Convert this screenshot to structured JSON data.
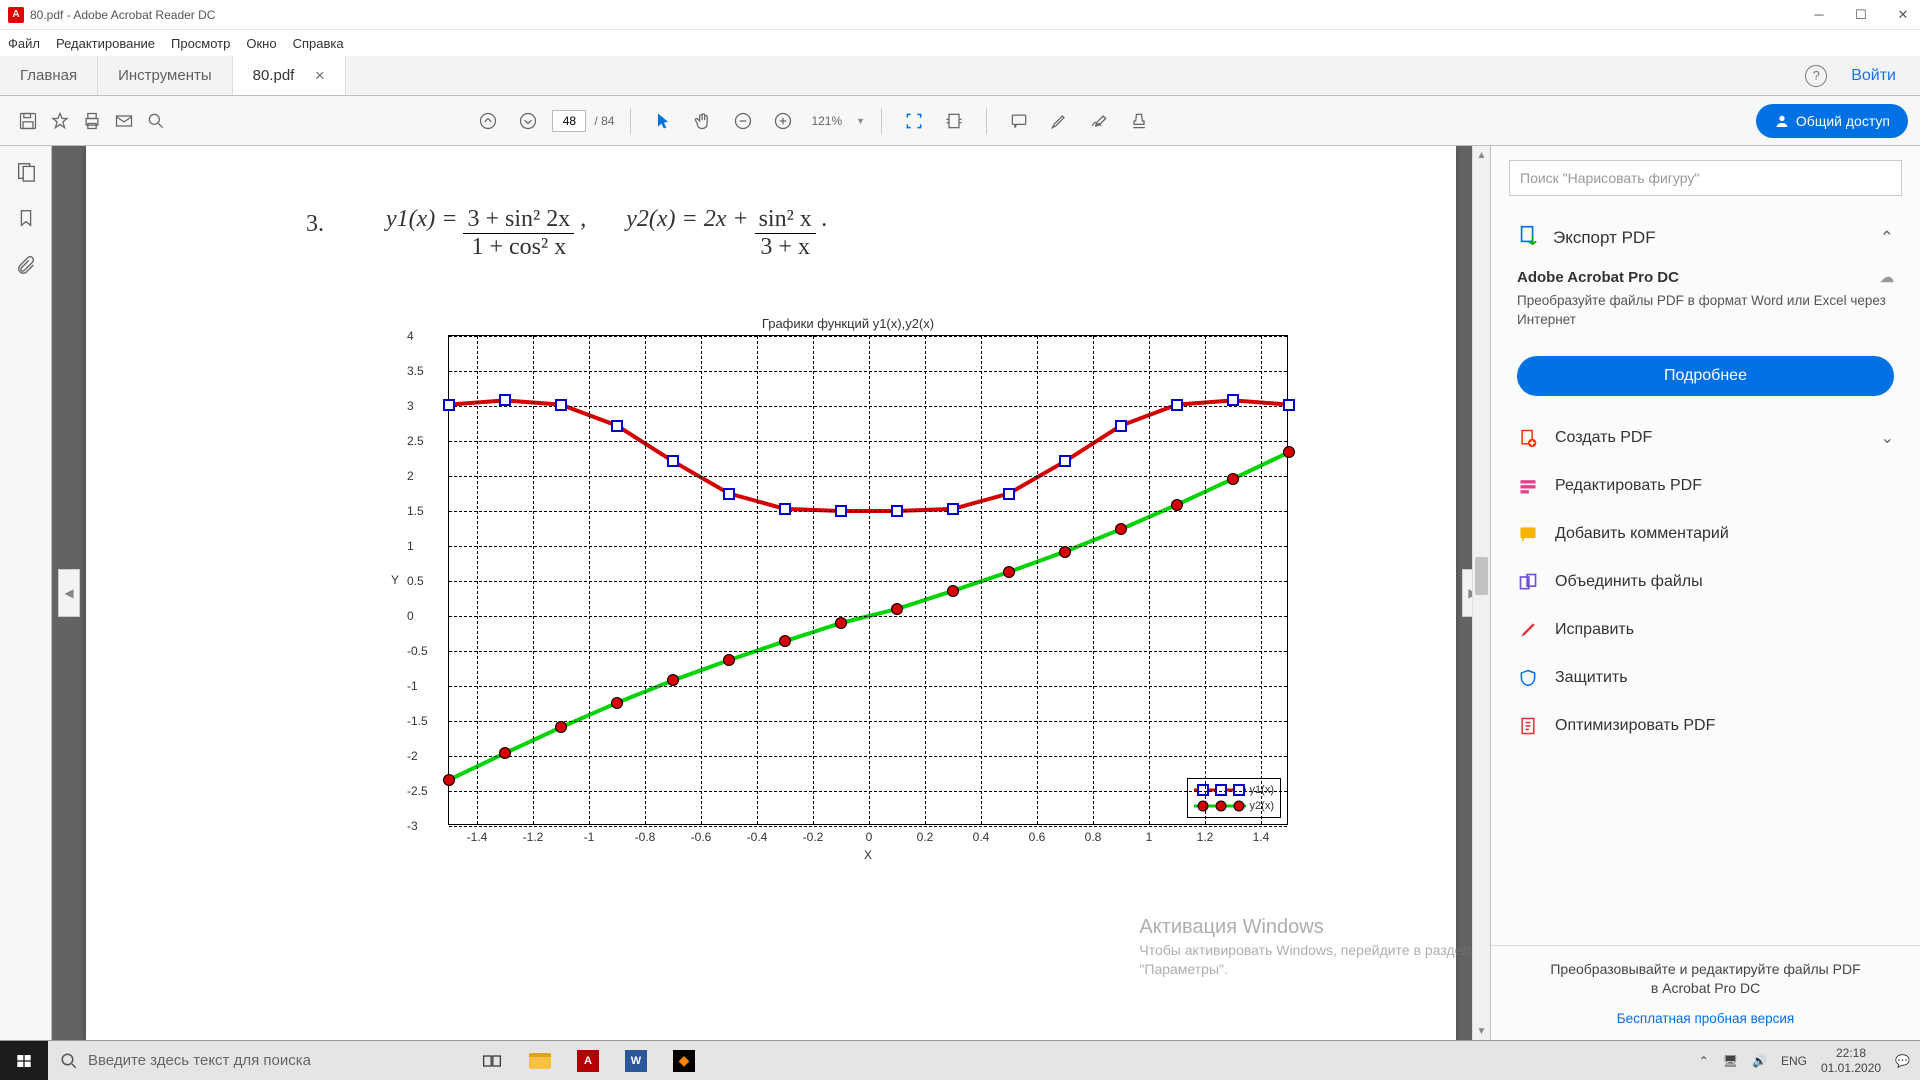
{
  "titlebar": {
    "title": "80.pdf - Adobe Acrobat Reader DC"
  },
  "menubar": [
    "Файл",
    "Редактирование",
    "Просмотр",
    "Окно",
    "Справка"
  ],
  "tabs": {
    "home": "Главная",
    "tools": "Инструменты",
    "doc": "80.pdf"
  },
  "tabbar_right": {
    "signin": "Войти"
  },
  "toolbar": {
    "page_cur": "48",
    "page_tot": "/ 84",
    "zoom": "121%"
  },
  "share_btn": "Общий доступ",
  "tools_panel": {
    "search_ph": "Поиск \"Нарисовать фигуру\"",
    "export_hd": "Экспорт PDF",
    "export_title": "Adobe Acrobat Pro DC",
    "export_desc": "Преобразуйте файлы PDF в формат Word или Excel через Интернет",
    "more": "Подробнее",
    "items": [
      {
        "label": "Создать PDF",
        "color": "#e30000",
        "chev": true
      },
      {
        "label": "Редактировать PDF",
        "color": "#e83e8c"
      },
      {
        "label": "Добавить комментарий",
        "color": "#f5b400"
      },
      {
        "label": "Объединить файлы",
        "color": "#6f52d8"
      },
      {
        "label": "Исправить",
        "color": "#d33"
      },
      {
        "label": "Защитить",
        "color": "#0071e3"
      },
      {
        "label": "Оптимизировать PDF",
        "color": "#d33"
      }
    ],
    "bottom1": "Преобразовывайте и редактируйте файлы PDF",
    "bottom2": "в Acrobat Pro DC",
    "bottom_link": "Бесплатная пробная версия"
  },
  "watermark": {
    "l1": "Активация Windows",
    "l2": "Чтобы активировать Windows, перейдите в раздел",
    "l3": "\"Параметры\"."
  },
  "document": {
    "item_num": "3.",
    "f1_lhs": "y1(x) = ",
    "f1_num": "3 + sin² 2x",
    "f1_den": "1 + cos² x",
    "comma": ",",
    "f2_lhs": "y2(x) = 2x + ",
    "f2_num": "sin² x",
    "f2_den": "3 + x",
    "dot": "."
  },
  "chart_data": {
    "type": "line",
    "title": "Графики функций y1(x),y2(x)",
    "xlabel": "X",
    "ylabel": "Y",
    "xlim": [
      -1.5,
      1.5
    ],
    "ylim": [
      -3,
      4
    ],
    "xticks": [
      -1.4,
      -1.2,
      -1,
      -0.8,
      -0.6,
      -0.4,
      -0.2,
      0,
      0.2,
      0.4,
      0.6,
      0.8,
      1,
      1.2,
      1.4
    ],
    "yticks": [
      -3,
      -2.5,
      -2,
      -1.5,
      -1,
      -0.5,
      0,
      0.5,
      1,
      1.5,
      2,
      2.5,
      3,
      3.5,
      4
    ],
    "x": [
      -1.5,
      -1.3,
      -1.1,
      -0.9,
      -0.7,
      -0.5,
      -0.3,
      -0.1,
      0.1,
      0.3,
      0.5,
      0.7,
      0.9,
      1.1,
      1.3,
      1.5
    ],
    "series": [
      {
        "name": "y1(x)",
        "color": "#d40000",
        "marker": "square",
        "marker_color": "#0000cc",
        "values": [
          3.02,
          3.08,
          3.02,
          2.72,
          2.21,
          1.75,
          1.53,
          1.5,
          1.5,
          1.53,
          1.75,
          2.21,
          2.72,
          3.02,
          3.08,
          3.02
        ]
      },
      {
        "name": "y2(x)",
        "color": "#00d400",
        "marker": "circle",
        "marker_color": "#d40000",
        "values": [
          -2.34,
          -1.96,
          -1.59,
          -1.24,
          -0.92,
          -0.63,
          -0.36,
          -0.1,
          0.1,
          0.36,
          0.63,
          0.92,
          1.24,
          1.59,
          1.96,
          2.34
        ]
      }
    ],
    "legend": [
      "y1(x)",
      "y2(x)"
    ]
  },
  "taskbar": {
    "search_ph": "Введите здесь текст для поиска",
    "lang": "ENG",
    "time": "22:18",
    "date": "01.01.2020"
  }
}
